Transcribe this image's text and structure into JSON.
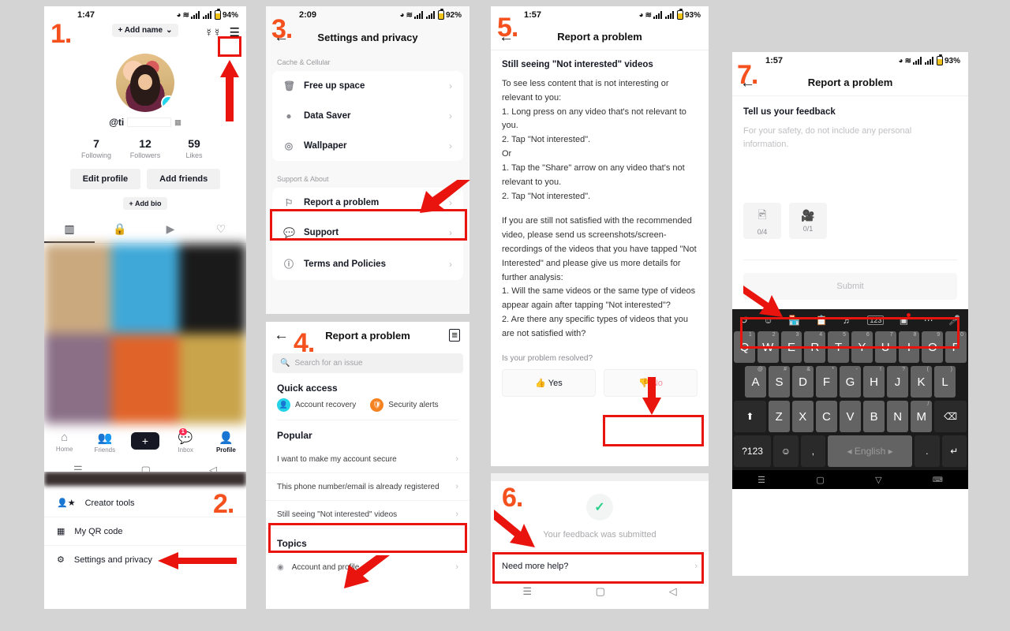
{
  "steps": {
    "s1": "1.",
    "s2": "2.",
    "s3": "3.",
    "s4": "4.",
    "s5": "5.",
    "s6": "6.",
    "s7": "7."
  },
  "colors": {
    "accent_red": "#e8140d",
    "step_orange": "#f4511e",
    "tiktok_pink": "#fe2c55",
    "tiktok_cyan": "#25f4ee"
  },
  "panel1": {
    "status": {
      "time": "1:47",
      "battery": "94%"
    },
    "add_name": "+ Add name",
    "handle": "@ti",
    "stats": [
      {
        "number": "7",
        "label": "Following"
      },
      {
        "number": "12",
        "label": "Followers"
      },
      {
        "number": "59",
        "label": "Likes"
      }
    ],
    "buttons": {
      "edit_profile": "Edit profile",
      "add_friends": "Add friends",
      "add_bio": "+ Add bio"
    },
    "tabs": [
      "grid-icon",
      "lock-icon",
      "repost-icon",
      "heart-icon"
    ],
    "tabbar": [
      {
        "label": "Home",
        "icon": "home-icon"
      },
      {
        "label": "Friends",
        "icon": "friends-icon"
      },
      {
        "label": "",
        "icon": "plus-icon"
      },
      {
        "label": "Inbox",
        "icon": "inbox-icon",
        "badge": "1"
      },
      {
        "label": "Profile",
        "icon": "profile-icon"
      }
    ]
  },
  "panel2": {
    "items": [
      {
        "label": "Creator tools",
        "icon": "creator-tools-icon"
      },
      {
        "label": "My QR code",
        "icon": "qr-code-icon"
      },
      {
        "label": "Settings and privacy",
        "icon": "gear-icon"
      }
    ]
  },
  "panel3": {
    "status": {
      "time": "2:09",
      "battery": "92%"
    },
    "title": "Settings and privacy",
    "section1_header": "Cache & Cellular",
    "section1": [
      {
        "label": "Free up space",
        "icon": "trash-icon"
      },
      {
        "label": "Data Saver",
        "icon": "data-saver-icon"
      },
      {
        "label": "Wallpaper",
        "icon": "wallpaper-icon"
      }
    ],
    "section2_header": "Support & About",
    "section2": [
      {
        "label": "Report a problem",
        "icon": "flag-icon"
      },
      {
        "label": "Support",
        "icon": "support-icon"
      },
      {
        "label": "Terms and Policies",
        "icon": "info-icon"
      }
    ]
  },
  "panel4": {
    "title": "Report a problem",
    "search_placeholder": "Search for an issue",
    "quick_access_header": "Quick access",
    "quick_access": [
      {
        "label": "Account recovery",
        "color": "#25d3e8"
      },
      {
        "label": "Security alerts",
        "color": "#f58220"
      }
    ],
    "popular_header": "Popular",
    "popular": [
      "I want to make my account secure",
      "This phone number/email is already registered",
      "Still seeing \"Not interested\" videos"
    ],
    "topics_header": "Topics",
    "topics": [
      {
        "label": "Account and profile",
        "icon": "account-icon"
      }
    ]
  },
  "panel5": {
    "status": {
      "time": "1:57",
      "battery": "93%"
    },
    "title": "Report a problem",
    "article_title": "Still seeing \"Not interested\" videos",
    "paragraph1": "To see less content that is not interesting or relevant to you:\n1. Long press on any video that's not relevant to you.\n2. Tap \"Not interested\".\nOr\n1. Tap the \"Share\" arrow on any video that's not relevant to you.\n2. Tap \"Not interested\".",
    "paragraph2": "If you are still not satisfied with the recommended video, please send us screenshots/screen-recordings of the videos that you have tapped \"Not Interested\" and please give us more details for further analysis:\n1. Will the same videos or the same type of videos appear again after tapping \"Not interested\"?\n2. Are there any specific types of videos that you are not satisfied with?",
    "resolved_question": "Is your problem resolved?",
    "yes_label": "Yes",
    "no_label": "No"
  },
  "panel6": {
    "submitted_text": "Your feedback was submitted",
    "need_more_help": "Need more help?"
  },
  "panel7": {
    "status": {
      "time": "1:57",
      "battery": "93%"
    },
    "title": "Report a problem",
    "feedback_header": "Tell us your feedback",
    "feedback_placeholder": "For your safety, do not include any personal information.",
    "photo_count": "0/4",
    "video_count": "0/1",
    "submit_label": "Submit",
    "keyboard": {
      "toolbar": [
        "translate-icon",
        "emoji-icon",
        "sticker-store-icon",
        "clipboard-icon",
        "theme-icon",
        "number-icon",
        "translate-box-icon",
        "more-icon",
        "mic-icon"
      ],
      "row1": [
        {
          "k": "Q",
          "alt": "1"
        },
        {
          "k": "W",
          "alt": "2"
        },
        {
          "k": "E",
          "alt": "3"
        },
        {
          "k": "R",
          "alt": "4"
        },
        {
          "k": "T",
          "alt": "5"
        },
        {
          "k": "Y",
          "alt": "6"
        },
        {
          "k": "U",
          "alt": "7"
        },
        {
          "k": "I",
          "alt": "8"
        },
        {
          "k": "O",
          "alt": "9"
        },
        {
          "k": "P",
          "alt": "0"
        }
      ],
      "row2": [
        {
          "k": "A",
          "alt": "@"
        },
        {
          "k": "S",
          "alt": "#"
        },
        {
          "k": "D",
          "alt": "&"
        },
        {
          "k": "F",
          "alt": "*"
        },
        {
          "k": "G",
          "alt": "-"
        },
        {
          "k": "H",
          "alt": "!"
        },
        {
          "k": "J",
          "alt": "?"
        },
        {
          "k": "K",
          "alt": "("
        },
        {
          "k": "L",
          "alt": ")"
        }
      ],
      "row3": [
        {
          "k": "Z",
          "alt": ""
        },
        {
          "k": "X",
          "alt": ""
        },
        {
          "k": "C",
          "alt": ""
        },
        {
          "k": "V",
          "alt": ""
        },
        {
          "k": "B",
          "alt": ""
        },
        {
          "k": "N",
          "alt": ""
        },
        {
          "k": "M",
          "alt": "/"
        }
      ],
      "shift": "⬆",
      "backspace": "⌫",
      "symbols": "?123",
      "emoji": "☺",
      "comma": ",",
      "space": "◂ English ▸",
      "period": ".",
      "enter": "↵"
    }
  }
}
